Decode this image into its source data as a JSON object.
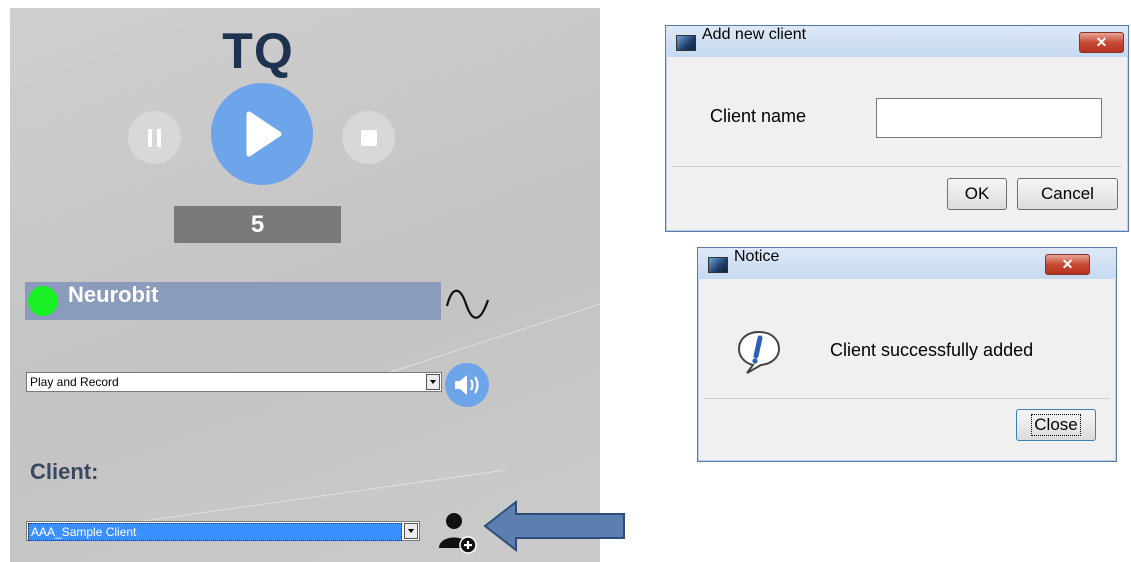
{
  "app": {
    "logo": "TQ",
    "counter": "5",
    "device": {
      "name": "Neurobit",
      "status_color": "#19f023"
    },
    "mode_select": {
      "value": "Play and Record"
    },
    "client_label": "Client:",
    "client_select": {
      "value": "AAA_Sample Client"
    },
    "accent_color": "#6ea4ea",
    "icons": [
      "pause-icon",
      "play-icon",
      "stop-icon",
      "signal-wave-icon",
      "speaker-icon",
      "add-user-icon"
    ]
  },
  "add_client_dialog": {
    "title": "Add new client",
    "field_label": "Client name",
    "field_value": "",
    "ok_label": "OK",
    "cancel_label": "Cancel",
    "close_glyph": "✕"
  },
  "notice_dialog": {
    "title": "Notice",
    "message": "Client successfully added",
    "close_label": "Close",
    "close_glyph": "✕"
  },
  "colors": {
    "arrow": "#5b80b0",
    "dialog_close": "#c74a36"
  }
}
